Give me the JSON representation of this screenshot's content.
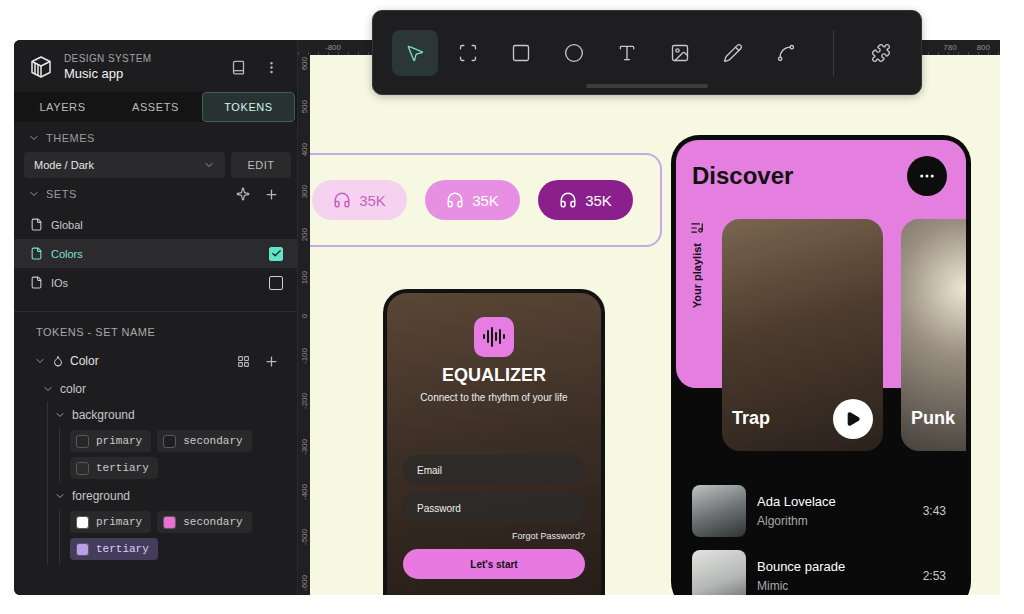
{
  "app": {
    "section": "DESIGN SYSTEM",
    "name": "Music app"
  },
  "tabs": [
    {
      "label": "LAYERS",
      "selected": false
    },
    {
      "label": "ASSETS",
      "selected": false
    },
    {
      "label": "TOKENS",
      "selected": true
    }
  ],
  "themes": {
    "heading": "THEMES",
    "expanded": true,
    "selected_theme": "Mode / Dark",
    "edit_button": "EDIT"
  },
  "sets": {
    "heading": "SETS",
    "expanded": true,
    "items": [
      {
        "name": "Global",
        "kind": "plain",
        "selected": false,
        "checked": false
      },
      {
        "name": "Colors",
        "kind": "toggle",
        "selected": true,
        "checked": true
      },
      {
        "name": "IOs",
        "kind": "toggle",
        "selected": false,
        "checked": false
      }
    ]
  },
  "tokens": {
    "heading": "TOKENS - SET NAME",
    "group": {
      "label": "Color",
      "expanded": true
    },
    "tree": {
      "label": "color",
      "expanded": true,
      "groups": [
        {
          "label": "background",
          "expanded": true,
          "tokens": [
            {
              "name": "primary",
              "color": "#262626",
              "selected": false
            },
            {
              "name": "secondary",
              "color": "#1f1f1f",
              "selected": false
            },
            {
              "name": "tertiary",
              "color": "#2b2b2b",
              "selected": false
            }
          ]
        },
        {
          "label": "foreground",
          "expanded": true,
          "tokens": [
            {
              "name": "primary",
              "color": "#ffffff",
              "selected": false
            },
            {
              "name": "secondary",
              "color": "#ec6fd6",
              "selected": false
            },
            {
              "name": "tertiary",
              "color": "#b9a0e6",
              "selected": true
            }
          ]
        }
      ]
    }
  },
  "rulers": {
    "top_left": [
      "-800"
    ],
    "top_right": [
      "780",
      "800"
    ],
    "left": [
      "600",
      "500",
      "400",
      "300",
      "200",
      "100",
      "0",
      "-100",
      "-200",
      "-300",
      "-400",
      "-500",
      "-600"
    ]
  },
  "toolbar": {
    "tools": [
      {
        "kind": "select",
        "selected": true
      },
      {
        "kind": "frame",
        "selected": false
      },
      {
        "kind": "rectangle",
        "selected": false
      },
      {
        "kind": "ellipse",
        "selected": false
      },
      {
        "kind": "text",
        "selected": false
      },
      {
        "kind": "image",
        "selected": false
      },
      {
        "kind": "pencil",
        "selected": false
      },
      {
        "kind": "path",
        "selected": false
      }
    ]
  },
  "canvas": {
    "stat_pills": [
      {
        "value": "35K",
        "color": "#f6d2f1"
      },
      {
        "value": "35K",
        "color": "#e78fe2"
      },
      {
        "value": "35K",
        "color": "#8b1f8c"
      }
    ],
    "login_screen": {
      "title": "EQUALIZER",
      "tagline": "Connect to the rhythm of your life",
      "fields": [
        {
          "placeholder": "Email"
        },
        {
          "placeholder": "Password"
        }
      ],
      "forgot_link": "Forgot Password?",
      "button": "Let's start"
    },
    "discover_screen": {
      "title": "Discover",
      "side_label": "Your playlist",
      "playlists": [
        {
          "label": "Trap"
        },
        {
          "label": "Punk"
        }
      ],
      "tracks": [
        {
          "title": "Ada Lovelace",
          "artist": "Algorithm",
          "duration": "3:43"
        },
        {
          "title": "Bounce parade",
          "artist": "Mimic",
          "duration": "2:53"
        }
      ]
    }
  }
}
